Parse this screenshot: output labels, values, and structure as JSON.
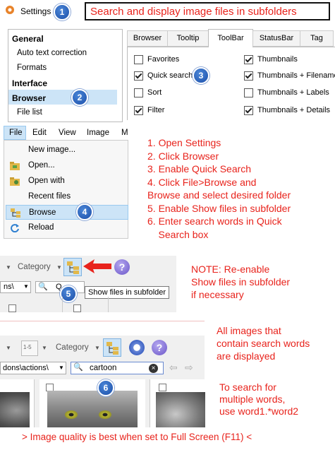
{
  "header": {
    "settings_label": "Settings",
    "badge": "1",
    "title_box": "Search and display image files in subfolders"
  },
  "settings": {
    "nav": [
      {
        "label": "General",
        "bold": true
      },
      {
        "label": "Auto text correction",
        "bold": false
      },
      {
        "label": "Formats",
        "bold": false
      },
      {
        "label": "Interface",
        "bold": true
      },
      {
        "label": "Browser",
        "bold": true,
        "selected": true
      },
      {
        "label": "File list",
        "bold": false
      }
    ],
    "badge": "2",
    "tabs": [
      "Browser",
      "Tooltip",
      "ToolBar",
      "StatusBar",
      "Tag"
    ],
    "active_tab": "ToolBar",
    "options_left": [
      {
        "label": "Favorites",
        "checked": false
      },
      {
        "label": "Quick search",
        "checked": true
      },
      {
        "label": "Sort",
        "checked": false
      },
      {
        "label": "Filter",
        "checked": true
      }
    ],
    "options_right": [
      {
        "label": "Thumbnails",
        "checked": true
      },
      {
        "label": "Thumbnails + Filename",
        "checked": true
      },
      {
        "label": "Thumbnails + Labels",
        "checked": false
      },
      {
        "label": "Thumbnails + Details",
        "checked": true
      }
    ],
    "badge3": "3"
  },
  "menu": {
    "bar": [
      "File",
      "Edit",
      "View",
      "Image",
      "M"
    ],
    "items": [
      {
        "label": "New image...",
        "icon": "none"
      },
      {
        "label": "Open...",
        "icon": "open-folder-icon"
      },
      {
        "label": "Open with",
        "icon": "open-with-icon"
      },
      {
        "label": "Recent files",
        "icon": "none"
      },
      {
        "label": "Browse",
        "icon": "browse-icon",
        "selected": true
      },
      {
        "label": "Reload",
        "icon": "reload-icon"
      }
    ],
    "badge": "4"
  },
  "steps": [
    "1. Open Settings",
    "2. Click Browser",
    "3. Enable Quick Search",
    "4. Click File>Browse and",
    "Browse and select desired folder",
    "5. Enable Show files in subfolder",
    "6. Enter search words in Quick",
    "    Search box"
  ],
  "toolbar1": {
    "category_label": "Category",
    "path_text": "ns\\",
    "search_placeholder": "Q",
    "tooltip": "Show files in subfolder",
    "badge": "5"
  },
  "note": [
    "NOTE: Re-enable",
    "Show files in subfolder",
    "if necessary"
  ],
  "toolbar2": {
    "date_label": "1-5",
    "category_label": "Category",
    "path_text": "dons\\actions\\",
    "search_value": "cartoon",
    "badge": "6"
  },
  "all_images_note": [
    "All images that",
    "contain search words",
    "are displayed"
  ],
  "multi_note": [
    "To search for",
    "multiple words,",
    "use word1.*word2"
  ],
  "footer": "> Image quality is best when set to Full Screen (F11) <",
  "colors": {
    "accent_red": "#e8231c",
    "selection_blue": "#cce4f7",
    "badge_blue": "#2a62c0"
  }
}
